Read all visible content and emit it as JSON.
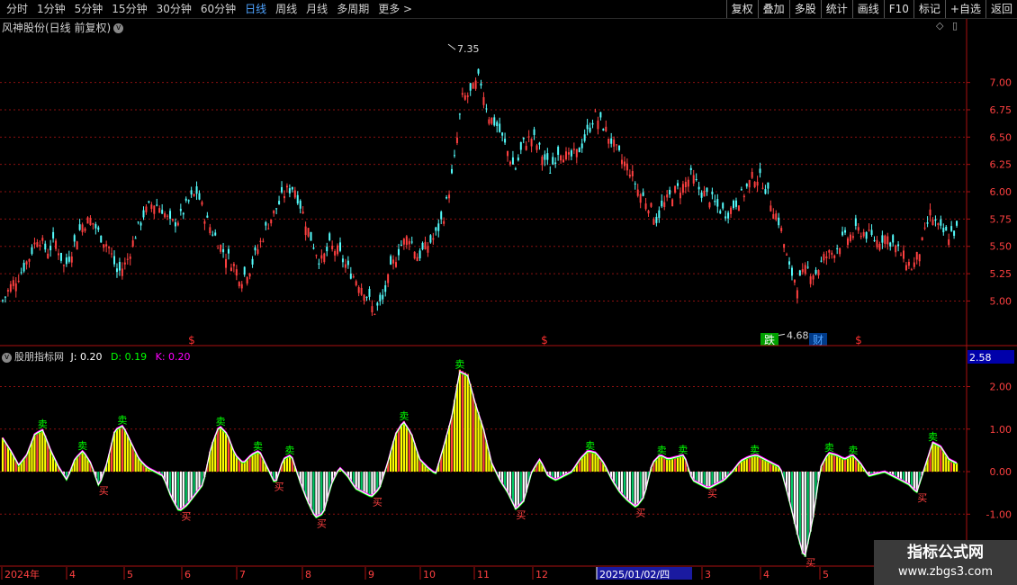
{
  "toolbar": {
    "left_items": [
      "分时",
      "1分钟",
      "5分钟",
      "15分钟",
      "30分钟",
      "60分钟",
      "日线",
      "周线",
      "月线",
      "多周期",
      "更多 >"
    ],
    "active_index": 6,
    "right_items": [
      "复权",
      "叠加",
      "多股",
      "统计",
      "画线",
      "F10",
      "标记",
      "+自选",
      "返回"
    ]
  },
  "main_title": "风神股份(日线 前复权)",
  "indicator": {
    "name": "股朋指标网",
    "j_label": "J: 0.20",
    "d_label": "D: 0.19",
    "k_label": "K: 0.20",
    "current_value": "2.58"
  },
  "annotations": {
    "high": "7.35",
    "low": "4.68",
    "markers": [
      "$",
      "$",
      "跌",
      "财",
      "$"
    ],
    "buy": "买",
    "sell": "卖"
  },
  "x_axis_labels": [
    "2024年",
    "4",
    "5",
    "6",
    "7",
    "8",
    "9",
    "10",
    "11",
    "12",
    "2025/01/02/四",
    "3",
    "4",
    "5"
  ],
  "watermark": {
    "line1": "指标公式网",
    "line2": "www.zbgs3.com"
  },
  "colors": {
    "up": "#ff4040",
    "down": "#54fcfc",
    "grid": "#8a1010",
    "yellow": "#ffff00",
    "j": "#ffffff",
    "d": "#00ff00",
    "k": "#ff00ff"
  },
  "chart_data": [
    {
      "type": "candlestick",
      "title": "风神股份(日线 前复权)",
      "yticks": [
        5.0,
        5.25,
        5.5,
        5.75,
        6.0,
        6.25,
        6.5,
        6.75,
        7.0
      ],
      "ylim": [
        4.6,
        7.45
      ],
      "x_months": [
        "2024年",
        "4",
        "5",
        "6",
        "7",
        "8",
        "9",
        "10",
        "11",
        "12",
        "2025/01/02/四",
        "3",
        "4",
        "5"
      ],
      "close_path": [
        5.0,
        5.15,
        5.25,
        5.4,
        5.6,
        5.45,
        5.55,
        5.3,
        5.5,
        5.7,
        5.75,
        5.6,
        5.5,
        5.25,
        5.35,
        5.6,
        5.8,
        5.9,
        5.85,
        5.7,
        5.75,
        5.9,
        6.0,
        5.75,
        5.6,
        5.45,
        5.35,
        5.2,
        5.3,
        5.5,
        5.7,
        5.85,
        6.0,
        6.05,
        5.8,
        5.55,
        5.35,
        5.5,
        5.45,
        5.3,
        5.2,
        5.1,
        4.9,
        5.0,
        5.3,
        5.5,
        5.6,
        5.4,
        5.5,
        5.6,
        5.8,
        6.2,
        6.85,
        6.9,
        7.05,
        6.7,
        6.6,
        6.4,
        6.2,
        6.45,
        6.5,
        6.35,
        6.2,
        6.4,
        6.3,
        6.35,
        6.5,
        6.7,
        6.6,
        6.45,
        6.3,
        6.2,
        6.0,
        5.9,
        5.75,
        5.9,
        6.0,
        6.05,
        6.15,
        6.0,
        5.95,
        5.85,
        5.8,
        5.9,
        6.0,
        6.15,
        6.1,
        5.9,
        5.7,
        5.3,
        5.15,
        5.3,
        5.25,
        5.4,
        5.45,
        5.55,
        5.6,
        5.65,
        5.6,
        5.55,
        5.6,
        5.5,
        5.4,
        5.3,
        5.5,
        5.8,
        5.65,
        5.6,
        5.65
      ],
      "high": 7.35,
      "low": 4.68
    },
    {
      "type": "bar",
      "title": "股朋指标网",
      "yticks": [
        -1.0,
        0.0,
        1.0,
        2.0
      ],
      "ylim": [
        -2.2,
        2.9
      ],
      "series": [
        {
          "name": "J",
          "values": [
            0.8,
            0.5,
            0.15,
            0.4,
            0.9,
            1.0,
            0.5,
            0.1,
            -0.2,
            0.3,
            0.5,
            0.2,
            -0.35,
            0.2,
            1.0,
            1.1,
            0.7,
            0.3,
            0.1,
            0.0,
            -0.1,
            -0.6,
            -0.95,
            -0.8,
            -0.55,
            -0.3,
            0.6,
            1.1,
            0.9,
            0.4,
            0.2,
            0.4,
            0.5,
            0.1,
            -0.3,
            0.3,
            0.4,
            -0.2,
            -0.7,
            -1.1,
            -1.0,
            -0.3,
            0.1,
            -0.1,
            -0.4,
            -0.5,
            -0.6,
            -0.4,
            0.2,
            0.9,
            1.2,
            0.9,
            0.3,
            0.1,
            -0.05,
            0.6,
            1.3,
            2.4,
            2.3,
            1.6,
            1.0,
            0.2,
            -0.2,
            -0.5,
            -0.9,
            -0.7,
            0.0,
            0.3,
            -0.1,
            -0.2,
            -0.1,
            0.0,
            0.3,
            0.5,
            0.45,
            0.2,
            -0.2,
            -0.5,
            -0.7,
            -0.85,
            -0.6,
            0.2,
            0.4,
            0.3,
            0.35,
            0.4,
            -0.2,
            -0.3,
            -0.4,
            -0.3,
            -0.2,
            0.0,
            0.25,
            0.35,
            0.4,
            0.3,
            0.2,
            0.1,
            -0.6,
            -1.4,
            -2.1,
            -1.2,
            0.1,
            0.45,
            0.4,
            0.3,
            0.4,
            0.2,
            -0.1,
            -0.05,
            0.0,
            -0.1,
            -0.2,
            -0.3,
            -0.5,
            0.1,
            0.7,
            0.6,
            0.3,
            0.2
          ]
        }
      ]
    }
  ]
}
